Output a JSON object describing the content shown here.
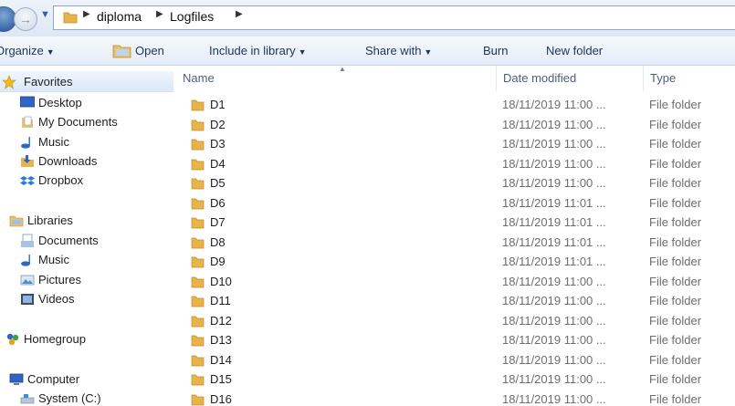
{
  "breadcrumb": [
    "diploma",
    "Logfiles"
  ],
  "toolbar": {
    "organize": "Organize",
    "open": "Open",
    "include_in_library": "Include in library",
    "share_with": "Share with",
    "burn": "Burn",
    "new_folder": "New folder"
  },
  "nav": {
    "favorites": "Favorites",
    "desktop": "Desktop",
    "my_documents": "My Documents",
    "music": "Music",
    "downloads": "Downloads",
    "dropbox": "Dropbox",
    "libraries": "Libraries",
    "lib_documents": "Documents",
    "lib_music": "Music",
    "lib_pictures": "Pictures",
    "lib_videos": "Videos",
    "homegroup": "Homegroup",
    "computer": "Computer",
    "system_c": "System (C:)"
  },
  "columns": {
    "name": "Name",
    "date_modified": "Date modified",
    "type": "Type"
  },
  "files": [
    {
      "name": "D1",
      "date": "18/11/2019 11:00 ...",
      "type": "File folder"
    },
    {
      "name": "D2",
      "date": "18/11/2019 11:00 ...",
      "type": "File folder"
    },
    {
      "name": "D3",
      "date": "18/11/2019 11:00 ...",
      "type": "File folder"
    },
    {
      "name": "D4",
      "date": "18/11/2019 11:00 ...",
      "type": "File folder"
    },
    {
      "name": "D5",
      "date": "18/11/2019 11:00 ...",
      "type": "File folder"
    },
    {
      "name": "D6",
      "date": "18/11/2019 11:01 ...",
      "type": "File folder"
    },
    {
      "name": "D7",
      "date": "18/11/2019 11:01 ...",
      "type": "File folder"
    },
    {
      "name": "D8",
      "date": "18/11/2019 11:01 ...",
      "type": "File folder"
    },
    {
      "name": "D9",
      "date": "18/11/2019 11:01 ...",
      "type": "File folder"
    },
    {
      "name": "D10",
      "date": "18/11/2019 11:00 ...",
      "type": "File folder"
    },
    {
      "name": "D11",
      "date": "18/11/2019 11:00 ...",
      "type": "File folder"
    },
    {
      "name": "D12",
      "date": "18/11/2019 11:00 ...",
      "type": "File folder"
    },
    {
      "name": "D13",
      "date": "18/11/2019 11:00 ...",
      "type": "File folder"
    },
    {
      "name": "D14",
      "date": "18/11/2019 11:00 ...",
      "type": "File folder"
    },
    {
      "name": "D15",
      "date": "18/11/2019 11:00 ...",
      "type": "File folder"
    },
    {
      "name": "D16",
      "date": "18/11/2019 11:00 ...",
      "type": "File folder"
    }
  ],
  "icons": {
    "folder": "folder-icon",
    "star": "star-icon",
    "desktop": "desktop-icon",
    "documents": "documents-icon",
    "music": "music-icon",
    "downloads": "downloads-icon",
    "dropbox": "dropbox-icon",
    "libraries": "libraries-icon",
    "pictures": "pictures-icon",
    "videos": "videos-icon",
    "homegroup": "homegroup-icon",
    "computer": "computer-icon",
    "drive": "drive-icon"
  },
  "colors": {
    "folder": "#e8b44a",
    "toolbar_text": "#1e3456",
    "header_text": "#4c607a",
    "meta_text": "#6d6d6d"
  }
}
